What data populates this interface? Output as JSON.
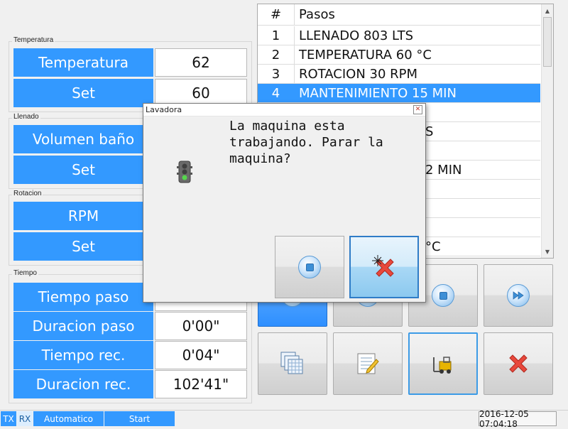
{
  "groups": {
    "temperatura": {
      "title": "Temperatura",
      "rows": [
        {
          "label": "Temperatura",
          "value": "62"
        },
        {
          "label": "Set",
          "value": "60"
        }
      ]
    },
    "llenado": {
      "title": "Llenado",
      "rows": [
        {
          "label": "Volumen baño",
          "value": ""
        },
        {
          "label": "Set",
          "value": ""
        }
      ]
    },
    "rotacion": {
      "title": "Rotacion",
      "rows": [
        {
          "label": "RPM",
          "value": ""
        },
        {
          "label": "Set",
          "value": ""
        }
      ]
    },
    "tiempo": {
      "title": "Tiempo",
      "rows": [
        {
          "label": "Tiempo paso",
          "value": ""
        },
        {
          "label": "Duracion paso",
          "value": "0'00\""
        },
        {
          "label": "Tiempo rec.",
          "value": "0'04\""
        },
        {
          "label": "Duracion rec.",
          "value": "102'41\""
        }
      ]
    }
  },
  "steps_table": {
    "headers": [
      "#",
      "Pasos"
    ],
    "rows": [
      {
        "num": "1",
        "step": "LLENADO 803 LTS"
      },
      {
        "num": "2",
        "step": "TEMPERATURA 60 °C"
      },
      {
        "num": "3",
        "step": "ROTACION 30 RPM"
      },
      {
        "num": "4",
        "step": "MANTENIMIENTO 15 MIN",
        "selected": true
      },
      {
        "num": "",
        "step": ""
      },
      {
        "num": "",
        "step": "S"
      },
      {
        "num": "",
        "step": ""
      },
      {
        "num": "",
        "step": "2 MIN"
      },
      {
        "num": "",
        "step": ""
      },
      {
        "num": "",
        "step": ""
      },
      {
        "num": "",
        "step": ""
      },
      {
        "num": "",
        "step": "°C"
      }
    ]
  },
  "dialog": {
    "title": "Lavadora",
    "message_lines": [
      "La maquina esta",
      "trabajando. Parar la",
      "maquina?"
    ],
    "icons": {
      "status": "traffic-light-icon",
      "confirm": "stop-icon",
      "cancel": "cancel-x-icon",
      "close": "close-icon"
    }
  },
  "status_bar": {
    "tx": "TX",
    "rx": "RX",
    "mode": "Automatico",
    "action": "Start",
    "datetime": "2016-12-05 07:04:18"
  },
  "colors": {
    "accent": "#3399ff",
    "cancel_red": "#e8483c"
  }
}
